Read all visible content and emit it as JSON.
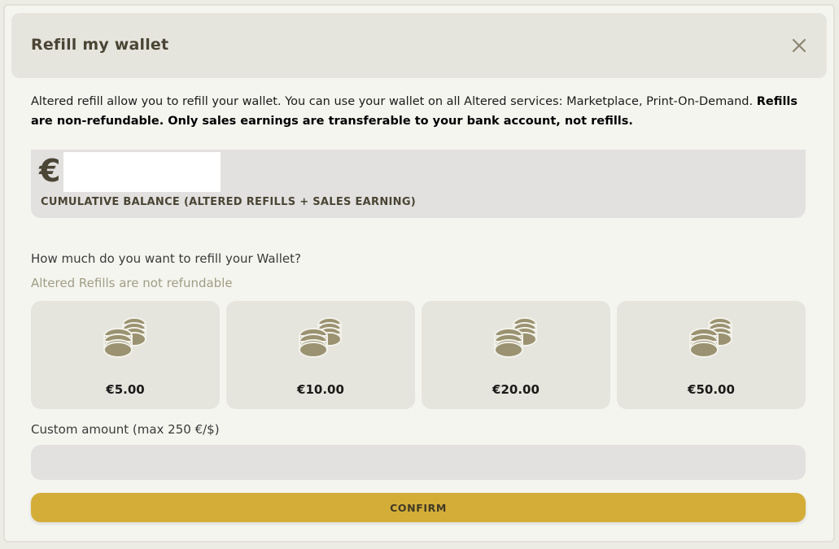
{
  "dialog": {
    "title": "Refill my wallet",
    "description_plain": "Altered refill allow you to refill your wallet. You can use your wallet on all Altered services: Marketplace, Print-On-Demand. ",
    "description_bold": "Refills are non-refundable. Only sales earnings are transferable to your bank account, not refills."
  },
  "balance": {
    "currency_symbol": "€",
    "label": "CUMULATIVE BALANCE (ALTERED REFILLS + SALES EARNING)"
  },
  "refill": {
    "question": "How much do you want to refill your Wallet?",
    "hint": "Altered Refills are not refundable",
    "options": [
      {
        "amount": "€5.00",
        "icon": "coins-icon"
      },
      {
        "amount": "€10.00",
        "icon": "coins-icon"
      },
      {
        "amount": "€20.00",
        "icon": "coins-icon"
      },
      {
        "amount": "€50.00",
        "icon": "coins-icon"
      }
    ],
    "custom_label": "Custom amount (max 250 €/$)",
    "custom_value": "",
    "confirm_label": "CONFIRM"
  },
  "colors": {
    "accent": "#d4ad38",
    "icon": "#9a9270",
    "title_text": "#4a4535"
  }
}
